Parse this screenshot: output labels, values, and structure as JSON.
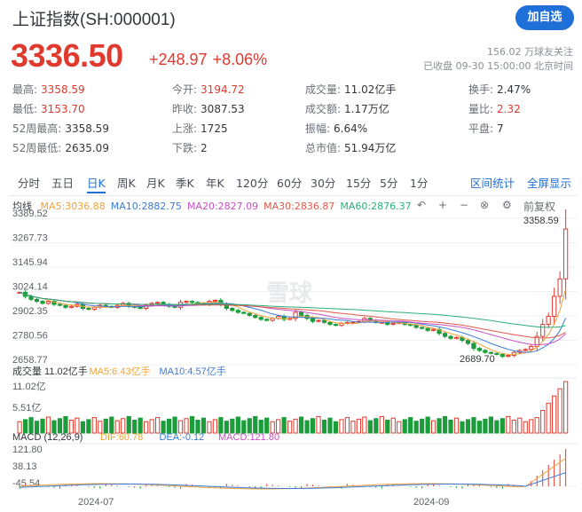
{
  "header": {
    "title": "上证指数(SH:000001)",
    "follow_label": "加自选",
    "price": "3336.50",
    "change": "+248.97",
    "change_pct": "+8.06%",
    "followers": "156.02 万球友关注",
    "status": "已收盘 09-30 15:00:00 北京时间"
  },
  "stats": [
    {
      "k": "最高:",
      "v": "3358.59",
      "c": "red"
    },
    {
      "k": "今开:",
      "v": "3194.72",
      "c": "red"
    },
    {
      "k": "成交量:",
      "v": "11.02亿手",
      "c": ""
    },
    {
      "k": "换手:",
      "v": "2.47%",
      "c": ""
    },
    {
      "k": "最低:",
      "v": "3153.70",
      "c": "red"
    },
    {
      "k": "昨收:",
      "v": "3087.53",
      "c": ""
    },
    {
      "k": "成交额:",
      "v": "1.17万亿",
      "c": ""
    },
    {
      "k": "量比:",
      "v": "2.32",
      "c": "red"
    },
    {
      "k": "52周最高:",
      "v": "3358.59",
      "c": ""
    },
    {
      "k": "上涨:",
      "v": "1725",
      "c": ""
    },
    {
      "k": "振幅:",
      "v": "6.64%",
      "c": ""
    },
    {
      "k": "平盘:",
      "v": "7",
      "c": ""
    },
    {
      "k": "52周最低:",
      "v": "2635.09",
      "c": ""
    },
    {
      "k": "下跌:",
      "v": "2",
      "c": ""
    },
    {
      "k": "总市值:",
      "v": "51.94万亿",
      "c": ""
    }
  ],
  "tabs": [
    "分时",
    "五日",
    "日K",
    "周K",
    "月K",
    "季K",
    "年K",
    "120分",
    "60分",
    "30分",
    "15分",
    "5分",
    "1分"
  ],
  "active_tab": "日K",
  "tab_links": [
    "区间统计",
    "全屏显示"
  ],
  "toolbar": {
    "line_label": "均线",
    "adjust_label": "前复权"
  },
  "ma": [
    {
      "label": "MA5:3036.88",
      "color": "#f2a33a"
    },
    {
      "label": "MA10:2882.75",
      "color": "#3b7bd6"
    },
    {
      "label": "MA20:2827.09",
      "color": "#c94fc7"
    },
    {
      "label": "MA30:2836.87",
      "color": "#e05a4a"
    },
    {
      "label": "MA60:2876.37",
      "color": "#2ab07a"
    }
  ],
  "vol_legend": [
    {
      "label": "成交量 11.02亿手",
      "color": "#33353c"
    },
    {
      "label": "MA5:6.43亿手",
      "color": "#f2a33a"
    },
    {
      "label": "MA10:4.57亿手",
      "color": "#3b7bd6"
    }
  ],
  "macd_legend": [
    {
      "label": "MACD (12,26,9)",
      "color": "#33353c"
    },
    {
      "label": "DIF:60.78",
      "color": "#f2a33a"
    },
    {
      "label": "DEA:-0.12",
      "color": "#3b7bd6"
    },
    {
      "label": "MACD:121.80",
      "color": "#c94fc7"
    }
  ],
  "watermark": "雪球",
  "colors": {
    "up": "#e03a2f",
    "down": "#1a9d3a",
    "accent": "#1f6fd8"
  },
  "chart_data": {
    "type": "candlestick",
    "price_axis": [
      "3389.52",
      "3267.73",
      "3145.94",
      "3024.14",
      "2902.35",
      "2780.56",
      "2658.77"
    ],
    "ylim": [
      2658.77,
      3389.52
    ],
    "vol_axis": [
      "11.02亿",
      "5.51亿"
    ],
    "macd_axis": [
      "121.80",
      "38.13",
      "-45.54"
    ],
    "x_ticks": [
      "2024-07",
      "2024-09"
    ],
    "annotations": {
      "high": "3358.59",
      "low": "2689.70"
    },
    "closes": [
      3020,
      3000,
      2985,
      2975,
      2965,
      2975,
      2960,
      2955,
      2945,
      2950,
      2960,
      2940,
      2935,
      2945,
      2955,
      2950,
      2945,
      2955,
      2965,
      2950,
      2945,
      2940,
      2955,
      2965,
      2970,
      2960,
      2950,
      2945,
      2970,
      2975,
      2970,
      2965,
      2960,
      2975,
      2980,
      2960,
      2940,
      2930,
      2920,
      2915,
      2905,
      2895,
      2885,
      2880,
      2890,
      2900,
      2885,
      2890,
      2920,
      2905,
      2890,
      2875,
      2880,
      2870,
      2860,
      2855,
      2865,
      2870,
      2870,
      2875,
      2890,
      2880,
      2870,
      2870,
      2860,
      2865,
      2870,
      2860,
      2855,
      2845,
      2840,
      2830,
      2835,
      2815,
      2800,
      2790,
      2795,
      2780,
      2765,
      2740,
      2730,
      2720,
      2715,
      2710,
      2700,
      2705,
      2720,
      2730,
      2735,
      2750,
      2800,
      2860,
      2900,
      3000,
      3087,
      3336
    ]
  }
}
